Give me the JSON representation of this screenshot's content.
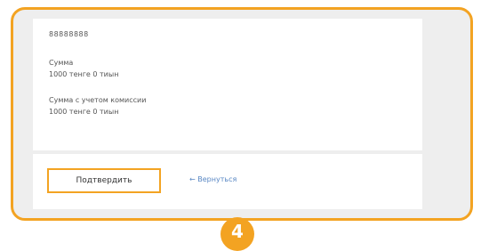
{
  "details": {
    "account_number": "88888888",
    "sum_label": "Сумма",
    "sum_value": "1000 тенге 0 тиын",
    "sum_with_fee_label": "Сумма с учетом комиссии",
    "sum_with_fee_value": "1000 тенге 0 тиын"
  },
  "actions": {
    "confirm_label": "Подтвердить",
    "back_label": "← Вернуться"
  },
  "step": {
    "number": "4"
  },
  "colors": {
    "accent": "#f3a322",
    "link": "#5a88c4"
  }
}
